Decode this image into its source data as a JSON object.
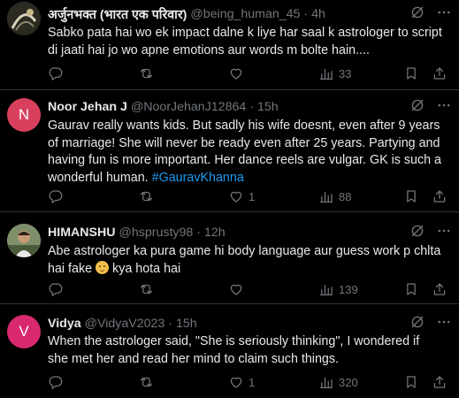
{
  "tweets": [
    {
      "name": "अर्जुनभक्त (भारत एक परिवार)",
      "handle": "@being_human_45",
      "dot": "·",
      "time": "4h",
      "text": "Sabko pata hai wo ek impact dalne k liye har saal k astrologer to script di jaati hai jo wo apne emotions aur words m bolte hain....",
      "replies": "",
      "retweets": "",
      "likes": "",
      "views": "33",
      "avatar": {
        "kind": "image",
        "initial": "",
        "color": "#3a3a2e"
      }
    },
    {
      "name": "Noor Jehan J",
      "handle": "@NoorJehanJ12864",
      "dot": "·",
      "time": "15h",
      "text": "Gaurav really wants kids. But sadly his wife doesnt, even after 9 years of marriage!  She will never be ready even after 25 years. Partying and having fun is more important.  Her dance reels are vulgar. GK is such a wonderful human.",
      "hashtag": "#GauravKhanna",
      "replies": "",
      "retweets": "",
      "likes": "1",
      "views": "88",
      "avatar": {
        "kind": "letter",
        "initial": "N",
        "color": "#d9405e"
      }
    },
    {
      "name": "HIMANSHU",
      "handle": "@hsprusty98",
      "dot": "·",
      "time": "12h",
      "text_before_emoji": "Abe astrologer ka pura game hi body language aur guess work p chlta hai fake",
      "text_after_emoji": "kya hota hai",
      "replies": "",
      "retweets": "",
      "likes": "",
      "views": "139",
      "avatar": {
        "kind": "image",
        "initial": "",
        "color": "#6b7d5a"
      }
    },
    {
      "name": "Vidya",
      "handle": "@VidyaV2023",
      "dot": "·",
      "time": "15h",
      "text": "When the astrologer said, \"She is seriously thinking\", I wondered if she met her and read her mind to claim such things.",
      "replies": "",
      "retweets": "",
      "likes": "1",
      "views": "320",
      "avatar": {
        "kind": "letter",
        "initial": "V",
        "color": "#d9286e"
      }
    }
  ],
  "colors": {
    "background": "#000000",
    "text": "#e7e9ea",
    "muted": "#71767b",
    "link": "#1d9bf0",
    "divider": "#2f3336"
  },
  "icons": [
    "grok-icon",
    "more-icon",
    "reply-icon",
    "retweet-icon",
    "like-icon",
    "views-icon",
    "bookmark-icon",
    "share-icon"
  ]
}
